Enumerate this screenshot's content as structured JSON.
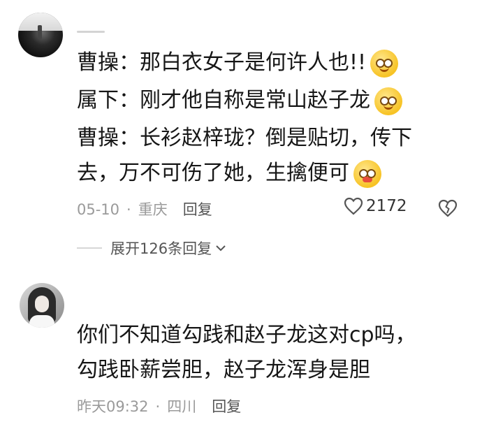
{
  "comment1": {
    "lines": [
      "曹操：那白衣女子是何许人也!!",
      "属下：刚才他自称是常山赵子龙",
      "曹操：长衫赵梓珑？倒是贴切，传下",
      "去，万不可伤了她，生擒便可"
    ],
    "date": "05-10",
    "separator": "·",
    "location": "重庆",
    "reply": "回复",
    "likes": "2172"
  },
  "expand_replies": "展开126条回复",
  "comment2": {
    "lines": [
      "你们不知道勾践和赵子龙这对cp吗，",
      "勾践卧薪尝胆，赵子龙浑身是胆"
    ],
    "date": "昨天09:32",
    "separator": "·",
    "location": "四川",
    "reply": "回复"
  },
  "icons": {
    "like": "heart-outline-icon",
    "dislike": "broken-heart-icon",
    "expand": "chevron-down-icon"
  }
}
